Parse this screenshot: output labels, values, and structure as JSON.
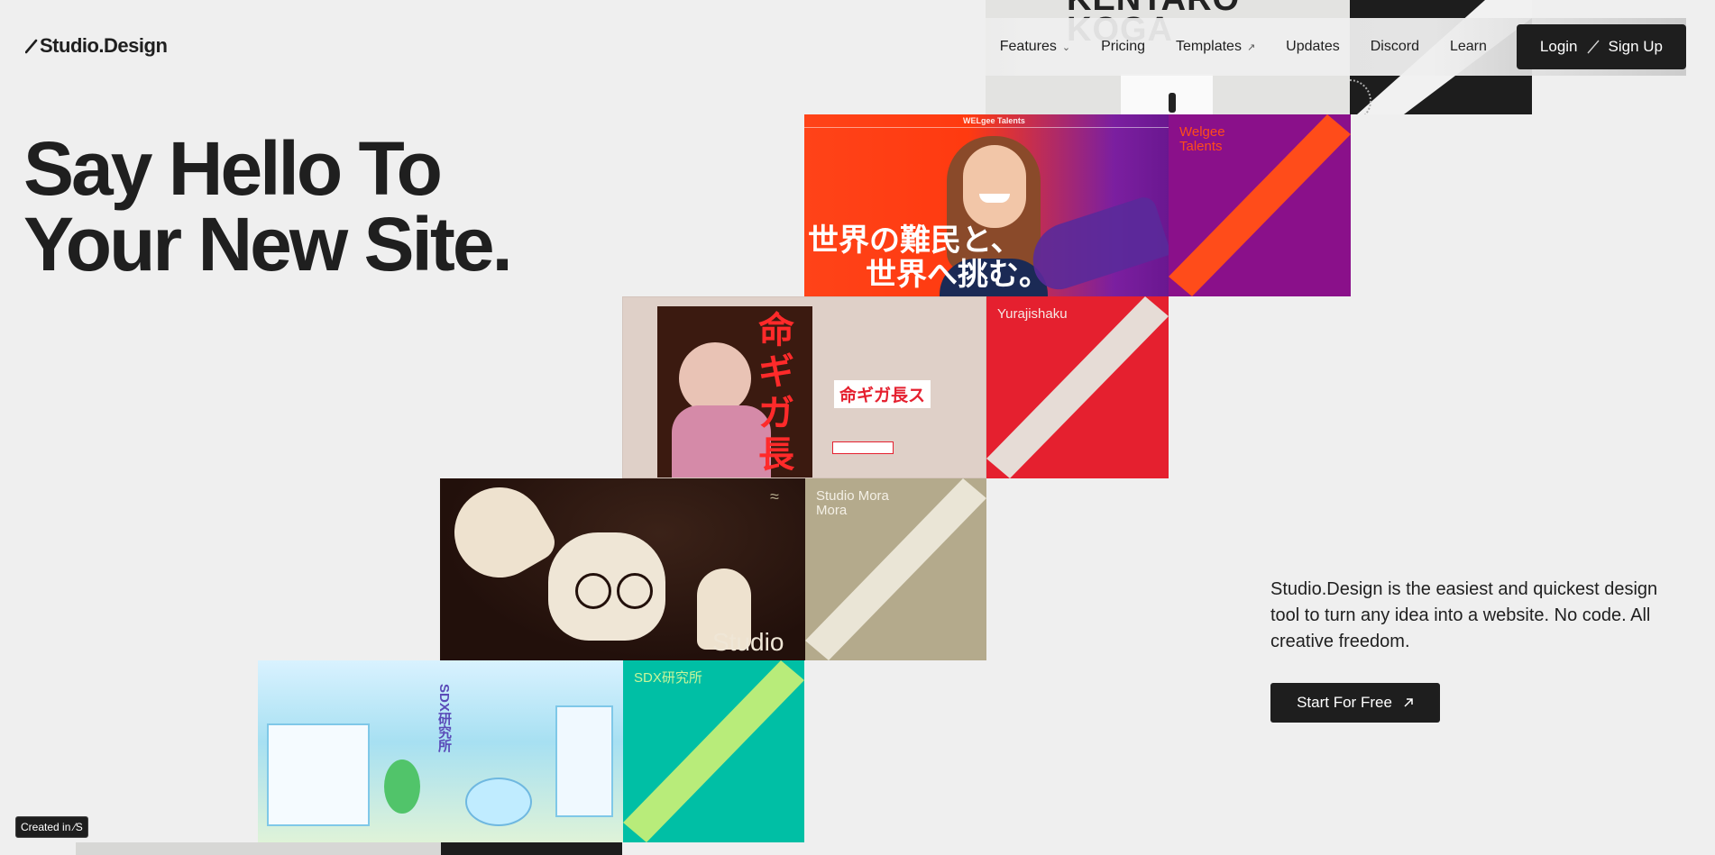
{
  "brand": {
    "name": "Studio.Design"
  },
  "nav": {
    "items": [
      {
        "label": "Features",
        "has_dropdown": true
      },
      {
        "label": "Pricing"
      },
      {
        "label": "Templates",
        "external": true
      },
      {
        "label": "Updates"
      },
      {
        "label": "Discord"
      },
      {
        "label": "Learn"
      }
    ],
    "login": "Login",
    "signup": "Sign Up"
  },
  "hero": {
    "line1": "Say Hello To",
    "line2": "Your New Site."
  },
  "description": "Studio.Design is the easiest and quickest design tool to turn any idea into a website. No code. All creative freedom.",
  "cta": {
    "label": "Start For Free"
  },
  "badge": {
    "label": "Created in ⁄S"
  },
  "showcase": [
    {
      "label": "Welgee Talents",
      "color": "#8a108a",
      "stripe": "#ff4c1a"
    },
    {
      "label": "Yurajishaku",
      "color": "#e5202f",
      "stripe": "#e6dcd6"
    },
    {
      "label": "Studio Mora Mora",
      "color": "#b4aa8c",
      "stripe": "#eae5d6"
    },
    {
      "label": "SDX研究所",
      "color": "#00bfa5",
      "stripe": "#b8ec7a"
    }
  ],
  "thumbs": {
    "kentaro": "KENTARO KOGA",
    "welgee_headline1": "世界の難民と、",
    "welgee_headline2": "世界へ挑む。",
    "welgee_brand": "WELgee Talents",
    "yura_title": "命ギガ長ス",
    "mora_word": "Studio",
    "sdx_vertical": "SDX研究所"
  },
  "colors": {
    "bg": "#efefef",
    "dark": "#1e1e1e"
  }
}
